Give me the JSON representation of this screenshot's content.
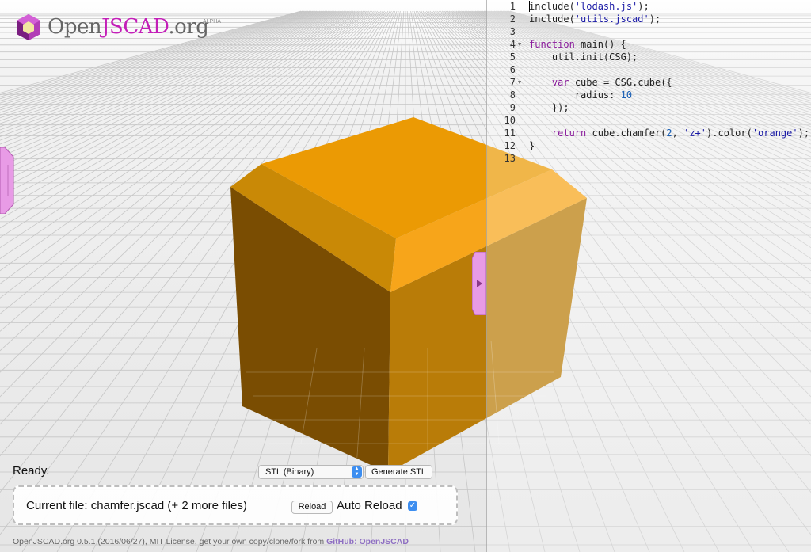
{
  "logo": {
    "open": "Open",
    "jscad": "JSCAD",
    "org": ".org",
    "alpha": "ALPHA"
  },
  "editor": {
    "lines": [
      {
        "num": "1",
        "fold": false,
        "parts": [
          {
            "t": "f",
            "v": "include("
          },
          {
            "t": "s",
            "v": "'lodash.js'"
          },
          {
            "t": "f",
            "v": ");"
          }
        ]
      },
      {
        "num": "2",
        "fold": false,
        "parts": [
          {
            "t": "f",
            "v": "include("
          },
          {
            "t": "s",
            "v": "'utils.jscad'"
          },
          {
            "t": "f",
            "v": ");"
          }
        ]
      },
      {
        "num": "3",
        "fold": false,
        "parts": []
      },
      {
        "num": "4",
        "fold": true,
        "parts": [
          {
            "t": "k",
            "v": "function"
          },
          {
            "t": "f",
            "v": " main() {"
          }
        ]
      },
      {
        "num": "5",
        "fold": false,
        "parts": [
          {
            "t": "f",
            "v": "    util.init(CSG);"
          }
        ]
      },
      {
        "num": "6",
        "fold": false,
        "parts": []
      },
      {
        "num": "7",
        "fold": true,
        "parts": [
          {
            "t": "f",
            "v": "    "
          },
          {
            "t": "k",
            "v": "var"
          },
          {
            "t": "f",
            "v": " cube = CSG.cube({"
          }
        ]
      },
      {
        "num": "8",
        "fold": false,
        "parts": [
          {
            "t": "f",
            "v": "        radius: "
          },
          {
            "t": "n",
            "v": "10"
          }
        ]
      },
      {
        "num": "9",
        "fold": false,
        "parts": [
          {
            "t": "f",
            "v": "    });"
          }
        ]
      },
      {
        "num": "10",
        "fold": false,
        "parts": []
      },
      {
        "num": "11",
        "fold": false,
        "parts": [
          {
            "t": "f",
            "v": "    "
          },
          {
            "t": "k",
            "v": "return"
          },
          {
            "t": "f",
            "v": " cube.chamfer("
          },
          {
            "t": "n",
            "v": "2"
          },
          {
            "t": "f",
            "v": ", "
          },
          {
            "t": "s",
            "v": "'z+'"
          },
          {
            "t": "f",
            "v": ").color("
          },
          {
            "t": "s",
            "v": "'orange'"
          },
          {
            "t": "f",
            "v": ");"
          }
        ]
      },
      {
        "num": "12",
        "fold": false,
        "parts": [
          {
            "t": "f",
            "v": "}"
          }
        ]
      },
      {
        "num": "13",
        "fold": false,
        "parts": []
      }
    ]
  },
  "status": {
    "text": "Ready."
  },
  "export": {
    "format": "STL (Binary)",
    "generate_label": "Generate STL"
  },
  "file_panel": {
    "current_file": "Current file: chamfer.jscad (+ 2 more files)",
    "reload_label": "Reload",
    "auto_reload_label": "Auto Reload",
    "auto_reload_checked": true
  },
  "footer": {
    "text": "OpenJSCAD.org 0.5.1 (2016/06/27), MIT License, get your own copy/clone/fork from ",
    "link": "GitHub: OpenJSCAD"
  },
  "colors": {
    "model": "#f0a020",
    "accent": "#c31fb8",
    "tab": "#e89be6",
    "checkbox": "#3d8ef0"
  }
}
